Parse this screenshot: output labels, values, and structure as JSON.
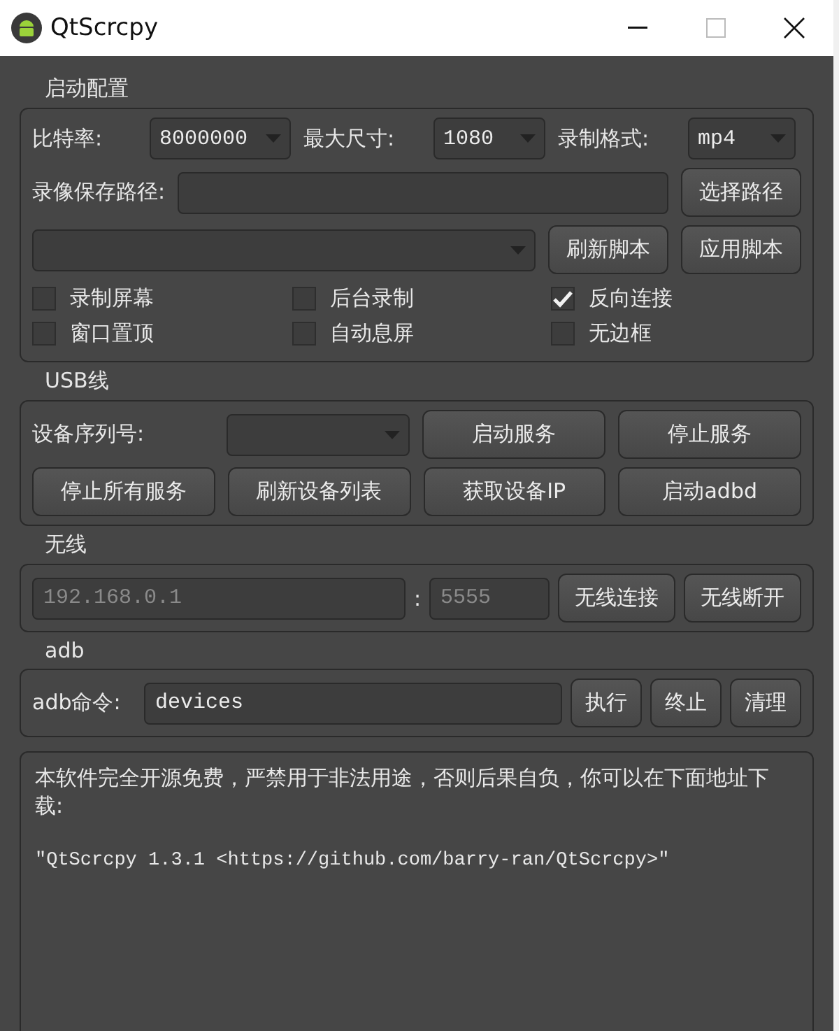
{
  "window": {
    "title": "QtScrcpy"
  },
  "config": {
    "title": "启动配置",
    "bitrate": {
      "label": "比特率:",
      "value": "8000000"
    },
    "max_size": {
      "label": "最大尺寸:",
      "value": "1080"
    },
    "record_format": {
      "label": "录制格式:",
      "value": "mp4"
    },
    "record_path": {
      "label": "录像保存路径:",
      "button": "选择路径"
    },
    "script_buttons": [
      "刷新脚本",
      "应用脚本"
    ],
    "options": [
      {
        "label": "录制屏幕",
        "checked": false
      },
      {
        "label": "后台录制",
        "checked": false
      },
      {
        "label": "反向连接",
        "checked": true
      },
      {
        "label": "窗口置顶",
        "checked": false
      },
      {
        "label": "自动息屏",
        "checked": false
      },
      {
        "label": "无边框",
        "checked": false
      }
    ]
  },
  "usb": {
    "title": "USB线",
    "serial_label": "设备序列号:",
    "buttons": [
      "启动服务",
      "停止服务",
      "停止所有服务",
      "刷新设备列表",
      "获取设备IP",
      "启动adbd"
    ]
  },
  "wireless": {
    "title": "无线",
    "ip": {
      "placeholder": "192.168.0.1"
    },
    "separator": ":",
    "port": {
      "placeholder": "5555"
    },
    "buttons": [
      "无线连接",
      "无线断开"
    ]
  },
  "adb": {
    "title": "adb",
    "label": "adb命令:",
    "value": "devices",
    "buttons": [
      "执行",
      "终止",
      "清理"
    ]
  },
  "output": {
    "notice": "本软件完全开源免费，严禁用于非法用途，否则后果自负，你可以在下面地址下载:",
    "download": "\"QtScrcpy 1.3.1 <https://github.com/barry-ran/QtScrcpy>\""
  }
}
